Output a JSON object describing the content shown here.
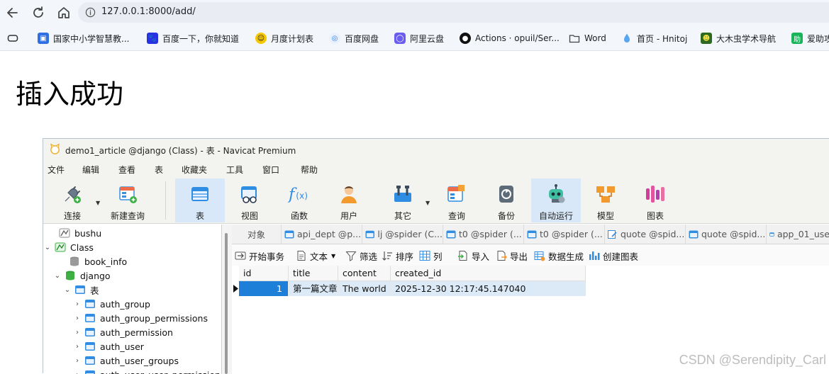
{
  "browser": {
    "url": "127.0.0.1:8000/add/",
    "bookmarks": [
      {
        "label": "国家中小学智慧教...",
        "icon": "smartedu-icon"
      },
      {
        "label": "百度一下，你就知道",
        "icon": "baidu-paw-icon"
      },
      {
        "label": "月度计划表",
        "icon": "smiley-icon"
      },
      {
        "label": "百度网盘",
        "icon": "baidu-netdisk-icon"
      },
      {
        "label": "阿里云盘",
        "icon": "aliyun-drive-icon"
      },
      {
        "label": "Actions · opuil/Ser...",
        "icon": "github-icon"
      },
      {
        "label": "Word",
        "icon": "folder-icon"
      },
      {
        "label": "首页 - Hnitoj",
        "icon": "drop-icon"
      },
      {
        "label": "大木虫学术导航",
        "icon": "bug-icon"
      },
      {
        "label": "爱助攻",
        "icon": "helper-icon"
      }
    ]
  },
  "page": {
    "heading": "插入成功"
  },
  "navicat": {
    "title": "demo1_article @django (Class) - 表 - Navicat Premium",
    "menu": [
      "文件",
      "编辑",
      "查看",
      "表",
      "收藏夹",
      "工具",
      "窗口",
      "帮助"
    ],
    "toolbar": [
      {
        "label": "连接",
        "icon": "connect-plug-icon"
      },
      {
        "label": "新建查询",
        "icon": "new-query-icon"
      },
      {
        "label": "表",
        "icon": "table-icon"
      },
      {
        "label": "视图",
        "icon": "view-icon"
      },
      {
        "label": "函数",
        "icon": "function-icon"
      },
      {
        "label": "用户",
        "icon": "user-icon"
      },
      {
        "label": "其它",
        "icon": "tools-icon"
      },
      {
        "label": "查询",
        "icon": "query-icon"
      },
      {
        "label": "备份",
        "icon": "backup-icon"
      },
      {
        "label": "自动运行",
        "icon": "robot-icon"
      },
      {
        "label": "模型",
        "icon": "model-icon"
      },
      {
        "label": "图表",
        "icon": "chart-icon"
      }
    ],
    "tree": [
      {
        "label": "bushu",
        "twisty": "",
        "icon": "mysql-conn-icon",
        "level": 0
      },
      {
        "label": "Class",
        "twisty": "⌄",
        "icon": "mysql-conn-icon",
        "level": 0
      },
      {
        "label": "book_info",
        "twisty": "",
        "icon": "database-icon",
        "level": 1
      },
      {
        "label": "django",
        "twisty": "⌄",
        "icon": "database-open-icon",
        "level": 1
      },
      {
        "label": "表",
        "twisty": "⌄",
        "icon": "table-folder-icon",
        "level": 2
      },
      {
        "label": "auth_group",
        "twisty": "›",
        "icon": "table-icon",
        "level": 3
      },
      {
        "label": "auth_group_permissions",
        "twisty": "›",
        "icon": "table-icon",
        "level": 3
      },
      {
        "label": "auth_permission",
        "twisty": "›",
        "icon": "table-icon",
        "level": 3
      },
      {
        "label": "auth_user",
        "twisty": "›",
        "icon": "table-icon",
        "level": 3
      },
      {
        "label": "auth_user_groups",
        "twisty": "›",
        "icon": "table-icon",
        "level": 3
      },
      {
        "label": "auth_user_user_permissions",
        "twisty": "›",
        "icon": "table-icon",
        "level": 3
      }
    ],
    "tabs": [
      {
        "label": "对象"
      },
      {
        "label": "api_dept @p..."
      },
      {
        "label": "lj @spider (C..."
      },
      {
        "label": "t0 @spider (..."
      },
      {
        "label": "t0 @spider (..."
      },
      {
        "label": "quote @spid..."
      },
      {
        "label": "quote @spid..."
      },
      {
        "label": "app_01_use"
      }
    ],
    "object_toolbar": [
      {
        "label": "开始事务",
        "icon": "transaction-icon"
      },
      {
        "label": "文本",
        "icon": "text-icon"
      },
      {
        "label": "筛选",
        "icon": "filter-icon"
      },
      {
        "label": "排序",
        "icon": "sort-icon"
      },
      {
        "label": "列",
        "icon": "columns-icon"
      },
      {
        "label": "导入",
        "icon": "import-icon"
      },
      {
        "label": "导出",
        "icon": "export-icon"
      },
      {
        "label": "数据生成",
        "icon": "data-generate-icon"
      },
      {
        "label": "创建图表",
        "icon": "create-chart-icon"
      }
    ],
    "grid": {
      "columns": [
        "id",
        "title",
        "content",
        "created_id"
      ],
      "rows": [
        [
          "1",
          "第一篇文章",
          "The world",
          "2025-12-30 12:17:45.147040"
        ]
      ]
    }
  },
  "watermark": "CSDN @Serendipity_Carl"
}
